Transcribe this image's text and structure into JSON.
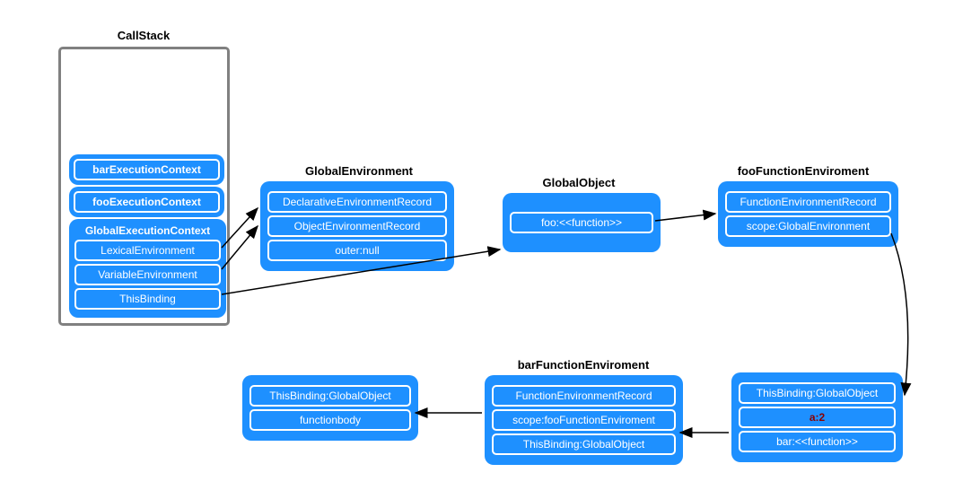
{
  "callstack": {
    "title": "CallStack",
    "bar": "barExecutionContext",
    "foo": "fooExecutionContext",
    "global": {
      "title": "GlobalExecutionContext",
      "lex": "LexicalEnvironment",
      "var": "VariableEnvironment",
      "this": "ThisBinding"
    }
  },
  "globalEnv": {
    "title": "GlobalEnvironment",
    "items": [
      "DeclarativeEnvironmentRecord",
      "ObjectEnvironmentRecord",
      "outer:null"
    ]
  },
  "globalObj": {
    "title": "GlobalObject",
    "items": [
      "foo:<<function>>"
    ]
  },
  "fooEnv": {
    "title": "fooFunctionEnviroment",
    "items": [
      "FunctionEnvironmentRecord",
      "scope:GlobalEnvironment"
    ]
  },
  "fooCtx": {
    "items": [
      "ThisBinding:GlobalObject",
      "a:2",
      "bar:<<function>>"
    ]
  },
  "barEnv": {
    "title": "barFunctionEnviroment",
    "items": [
      "FunctionEnvironmentRecord",
      "scope:fooFunctionEnviroment",
      "ThisBinding:GlobalObject"
    ]
  },
  "barCtx": {
    "items": [
      "ThisBinding:GlobalObject",
      "functionbody"
    ]
  }
}
